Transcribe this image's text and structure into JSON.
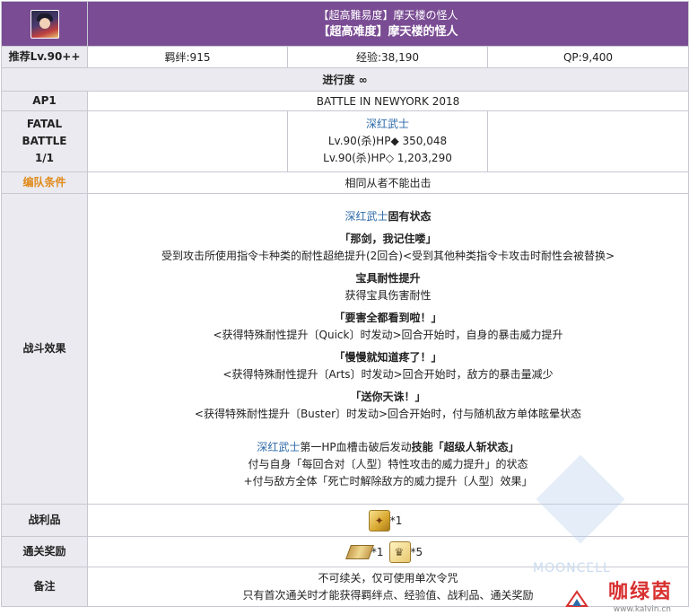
{
  "header": {
    "title_jp": "【超高難易度】摩天楼の怪人",
    "title_cn": "【超高难度】摩天楼的怪人"
  },
  "info": {
    "recommend": "推荐Lv.90++",
    "bond": "羁绊:915",
    "exp": "经验:38,190",
    "qp": "QP:9,400"
  },
  "progress": "进行度 ∞",
  "ap": {
    "label": "AP1",
    "value": "BATTLE IN NEWYORK 2018"
  },
  "battle": {
    "label_lines": [
      "FATAL",
      "BATTLE",
      "1/1"
    ],
    "enemy_name": "深红武士",
    "hp_lines": [
      "Lv.90(杀)HP◆ 350,048",
      "Lv.90(杀)HP◇ 1,203,290"
    ]
  },
  "condition": {
    "label": "编队条件",
    "value": "相同从者不能出击"
  },
  "effects": {
    "label": "战斗效果",
    "heading_name": "深红武士",
    "heading_suffix": "固有状态",
    "blocks": [
      {
        "title": "「那剑，我记住喽」",
        "desc": "受到攻击所使用指令卡种类的耐性超绝提升(2回合)<受到其他种类指令卡攻击时耐性会被替换>"
      },
      {
        "title": "宝具耐性提升",
        "desc": "获得宝具伤害耐性"
      },
      {
        "title": "「要害全都看到啦！」",
        "desc": "<获得特殊耐性提升〔Quick〕时发动>回合开始时，自身的暴击威力提升"
      },
      {
        "title": "「慢慢就知道疼了！」",
        "desc": "<获得特殊耐性提升〔Arts〕时发动>回合开始时，敌方的暴击量减少"
      },
      {
        "title": "「送你天诛！」",
        "desc": "<获得特殊耐性提升〔Buster〕时发动>回合开始时，付与随机敌方单体眩晕状态"
      }
    ],
    "final": {
      "name": "深红武士",
      "mid": "第一HP血槽击破后发动",
      "skill_word": "技能",
      "skill_name": "「超级人斩状态」",
      "line2": "付与自身「每回合对〔人型〕特性攻击的威力提升」的状态",
      "line3": "+付与敌方全体「死亡时解除敌方的威力提升〔人型〕效果」"
    }
  },
  "drops": {
    "label": "战利品",
    "count": "*1"
  },
  "reward": {
    "label": "通关奖励",
    "count1": "*1",
    "count2": "*5"
  },
  "notes": {
    "label": "备注",
    "line1": "不可续关，仅可使用单次令咒",
    "line2": "只有首次通关时才能获得羁绊点、经验值、战利品、通关奖励"
  },
  "watermark": {
    "site_name": "咖绿茵",
    "url": "www.kalvin.cn",
    "faint_text": "MOONCELL"
  },
  "colors": {
    "header_bg": "#7a4c93",
    "label_bg": "#eaeaf0",
    "link": "#2d6aa8",
    "orange_label": "#e08a1a",
    "watermark_red": "#d83030"
  }
}
